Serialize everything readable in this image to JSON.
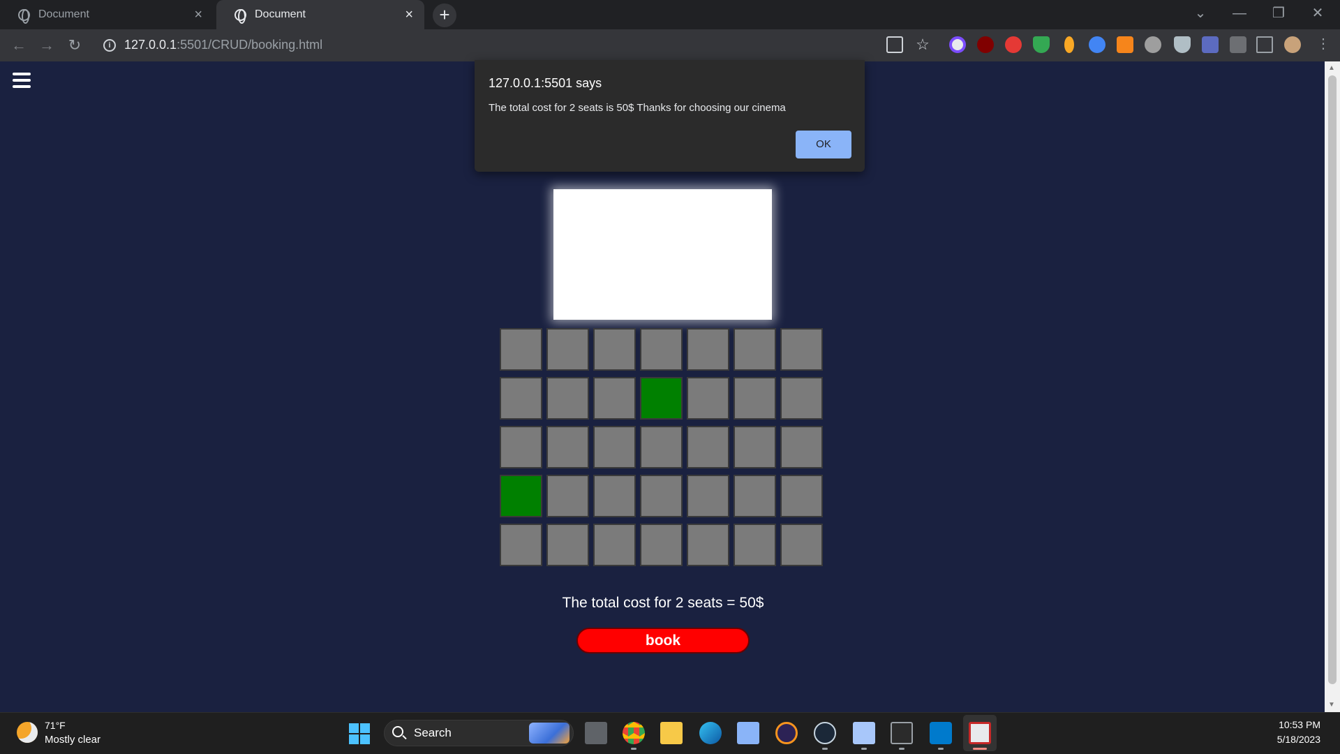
{
  "browser": {
    "tabs": [
      {
        "title": "Document",
        "active": false
      },
      {
        "title": "Document",
        "active": true
      }
    ],
    "new_tab_label": "+",
    "address": {
      "host": "127.0.0.1",
      "path": ":5501/CRUD/booking.html"
    },
    "info_icon_glyph": "i",
    "icons": {
      "tab": "globe-icon",
      "back": "back-arrow-icon",
      "forward": "forward-arrow-icon",
      "reload": "reload-icon",
      "share": "share-icon",
      "bookmark": "star-icon",
      "extensions": [
        "blocker-extension-icon",
        "ublock-extension-icon",
        "abp-extension-icon",
        "shield-green-extension-icon",
        "dropper-extension-icon",
        "translate-extension-icon",
        "metamask-extension-icon",
        "proxy-extension-icon",
        "privacy-shield-extension-icon",
        "tool-extension-icon",
        "puzzle-icon",
        "sidepanel-icon",
        "profile-avatar",
        "kebab-menu-icon"
      ]
    }
  },
  "alert": {
    "origin": "127.0.0.1:5501 says",
    "message": "The total cost for 2 seats is 50$ Thanks for choosing our cinema",
    "ok_label": "OK"
  },
  "page": {
    "menu_icon": "hamburger-icon",
    "seats": {
      "rows": 5,
      "columns": 7,
      "selected": [
        [
          1,
          3
        ],
        [
          3,
          0
        ]
      ],
      "colors": {
        "available": "#7b7b7b",
        "selected": "#008000"
      }
    },
    "total_text": "The total cost for 2 seats = 50$",
    "book_label": "book",
    "book_color": "#ff0000"
  },
  "taskbar": {
    "weather": {
      "temp": "71°F",
      "desc": "Mostly clear"
    },
    "search_label": "Search",
    "apps": [
      "task-view-icon",
      "chrome-icon",
      "file-explorer-icon",
      "edge-icon",
      "photos-icon",
      "eclipse-icon",
      "steam-icon",
      "notepad-icon",
      "terminal-icon",
      "vscode-icon",
      "snipping-tool-icon"
    ],
    "clock": {
      "time": "10:53 PM",
      "date": "5/18/2023"
    }
  }
}
